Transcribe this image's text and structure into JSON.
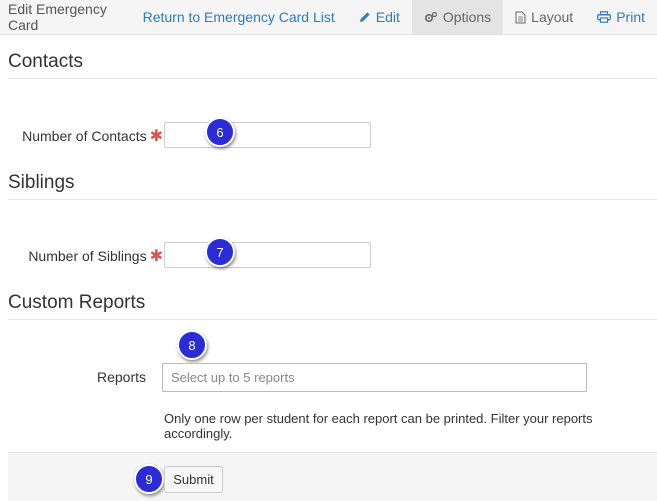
{
  "nav": {
    "title": "Edit Emergency Card",
    "return_link": "Return to Emergency Card List",
    "edit": "Edit",
    "options": "Options",
    "layout": "Layout",
    "print": "Print"
  },
  "sections": {
    "contacts": {
      "heading": "Contacts",
      "label": "Number of Contacts",
      "value": "",
      "step": "6"
    },
    "siblings": {
      "heading": "Siblings",
      "label": "Number of Siblings",
      "value": "",
      "step": "7"
    },
    "reports": {
      "heading": "Custom Reports",
      "label": "Reports",
      "placeholder": "Select up to 5 reports",
      "step": "8",
      "help": "Only one row per student for each report can be printed. Filter your reports accordingly."
    }
  },
  "footer": {
    "submit_label": "Submit",
    "step": "9"
  },
  "colors": {
    "link": "#2f7bbf",
    "required": "#d9534f",
    "badge": "#2c2cd4"
  }
}
